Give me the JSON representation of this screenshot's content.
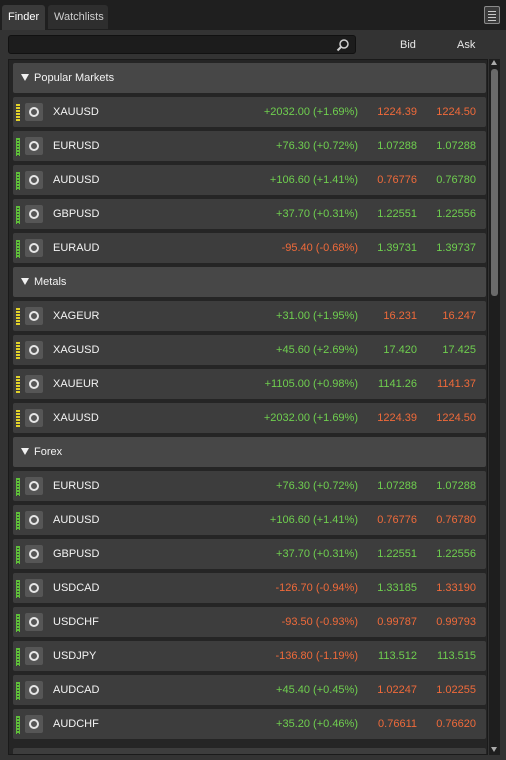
{
  "tabs": [
    {
      "label": "Finder",
      "active": true
    },
    {
      "label": "Watchlists",
      "active": false
    }
  ],
  "search": {
    "placeholder": "",
    "value": ""
  },
  "columns": {
    "bid": "Bid",
    "ask": "Ask"
  },
  "colors": {
    "positive": "#6fcf4f",
    "negative": "#f06a3a",
    "neutral": "#f4f4f4"
  },
  "groups": [
    {
      "title": "Popular Markets",
      "rows": [
        {
          "symbol": "XAUUSD",
          "change": "+2032.00 (+1.69%)",
          "change_dir": "pos",
          "bid": "1224.39",
          "bid_dir": "neg",
          "ask": "1224.50",
          "ask_dir": "neg",
          "bar": "yellow"
        },
        {
          "symbol": "EURUSD",
          "change": "+76.30 (+0.72%)",
          "change_dir": "pos",
          "bid": "1.07288",
          "bid_dir": "pos",
          "ask": "1.07288",
          "ask_dir": "pos",
          "bar": "green"
        },
        {
          "symbol": "AUDUSD",
          "change": "+106.60 (+1.41%)",
          "change_dir": "pos",
          "bid": "0.76776",
          "bid_dir": "neg",
          "ask": "0.76780",
          "ask_dir": "pos",
          "bar": "green"
        },
        {
          "symbol": "GBPUSD",
          "change": "+37.70 (+0.31%)",
          "change_dir": "pos",
          "bid": "1.22551",
          "bid_dir": "pos",
          "ask": "1.22556",
          "ask_dir": "pos",
          "bar": "green"
        },
        {
          "symbol": "EURAUD",
          "change": "-95.40 (-0.68%)",
          "change_dir": "neg",
          "bid": "1.39731",
          "bid_dir": "pos",
          "ask": "1.39737",
          "ask_dir": "pos",
          "bar": "green"
        }
      ]
    },
    {
      "title": "Metals",
      "rows": [
        {
          "symbol": "XAGEUR",
          "change": "+31.00 (+1.95%)",
          "change_dir": "pos",
          "bid": "16.231",
          "bid_dir": "neg",
          "ask": "16.247",
          "ask_dir": "neg",
          "bar": "yellow"
        },
        {
          "symbol": "XAGUSD",
          "change": "+45.60 (+2.69%)",
          "change_dir": "pos",
          "bid": "17.420",
          "bid_dir": "pos",
          "ask": "17.425",
          "ask_dir": "pos",
          "bar": "yellow"
        },
        {
          "symbol": "XAUEUR",
          "change": "+1105.00 (+0.98%)",
          "change_dir": "pos",
          "bid": "1141.26",
          "bid_dir": "pos",
          "ask": "1141.37",
          "ask_dir": "neg",
          "bar": "yellow"
        },
        {
          "symbol": "XAUUSD",
          "change": "+2032.00 (+1.69%)",
          "change_dir": "pos",
          "bid": "1224.39",
          "bid_dir": "neg",
          "ask": "1224.50",
          "ask_dir": "neg",
          "bar": "yellow"
        }
      ]
    },
    {
      "title": "Forex",
      "rows": [
        {
          "symbol": "EURUSD",
          "change": "+76.30 (+0.72%)",
          "change_dir": "pos",
          "bid": "1.07288",
          "bid_dir": "pos",
          "ask": "1.07288",
          "ask_dir": "pos",
          "bar": "green"
        },
        {
          "symbol": "AUDUSD",
          "change": "+106.60 (+1.41%)",
          "change_dir": "pos",
          "bid": "0.76776",
          "bid_dir": "neg",
          "ask": "0.76780",
          "ask_dir": "neg",
          "bar": "green"
        },
        {
          "symbol": "GBPUSD",
          "change": "+37.70 (+0.31%)",
          "change_dir": "pos",
          "bid": "1.22551",
          "bid_dir": "pos",
          "ask": "1.22556",
          "ask_dir": "pos",
          "bar": "green"
        },
        {
          "symbol": "USDCAD",
          "change": "-126.70 (-0.94%)",
          "change_dir": "neg",
          "bid": "1.33185",
          "bid_dir": "pos",
          "ask": "1.33190",
          "ask_dir": "neg",
          "bar": "green"
        },
        {
          "symbol": "USDCHF",
          "change": "-93.50 (-0.93%)",
          "change_dir": "neg",
          "bid": "0.99787",
          "bid_dir": "neg",
          "ask": "0.99793",
          "ask_dir": "neg",
          "bar": "green"
        },
        {
          "symbol": "USDJPY",
          "change": "-136.80 (-1.19%)",
          "change_dir": "neg",
          "bid": "113.512",
          "bid_dir": "pos",
          "ask": "113.515",
          "ask_dir": "pos",
          "bar": "green"
        },
        {
          "symbol": "AUDCAD",
          "change": "+45.40 (+0.45%)",
          "change_dir": "pos",
          "bid": "1.02247",
          "bid_dir": "neg",
          "ask": "1.02255",
          "ask_dir": "neg",
          "bar": "green"
        },
        {
          "symbol": "AUDCHF",
          "change": "+35.20 (+0.46%)",
          "change_dir": "pos",
          "bid": "0.76611",
          "bid_dir": "neg",
          "ask": "0.76620",
          "ask_dir": "neg",
          "bar": "green"
        }
      ]
    }
  ]
}
